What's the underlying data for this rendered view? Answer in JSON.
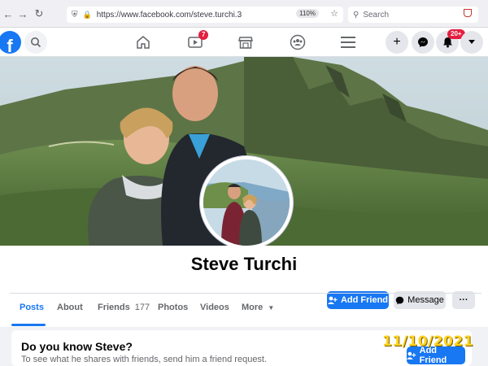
{
  "browser": {
    "url": "https://www.facebook.com/steve.turchi.3",
    "zoom": "110%",
    "search_placeholder": "Search"
  },
  "fb_nav": {
    "logo": "f",
    "video_badge": "7",
    "notifications_badge": "20+"
  },
  "profile": {
    "name": "Steve Turchi",
    "add_friend_label": "Add Friend",
    "message_label": "Message",
    "more_actions_label": "···"
  },
  "tabs": [
    {
      "label": "Posts",
      "active": true
    },
    {
      "label": "About"
    },
    {
      "label": "Friends",
      "count": "177"
    },
    {
      "label": "Photos"
    },
    {
      "label": "Videos"
    },
    {
      "label": "More"
    }
  ],
  "know_card": {
    "title": "Do you know Steve?",
    "subtitle": "To see what he shares with friends, send him a friend request.",
    "button_label": "Add Friend"
  },
  "timestamp": "11/10/2021",
  "colors": {
    "facebook_blue": "#1877f2",
    "badge_red": "#e41e3f",
    "date_stamp_yellow": "#ffd21e"
  }
}
